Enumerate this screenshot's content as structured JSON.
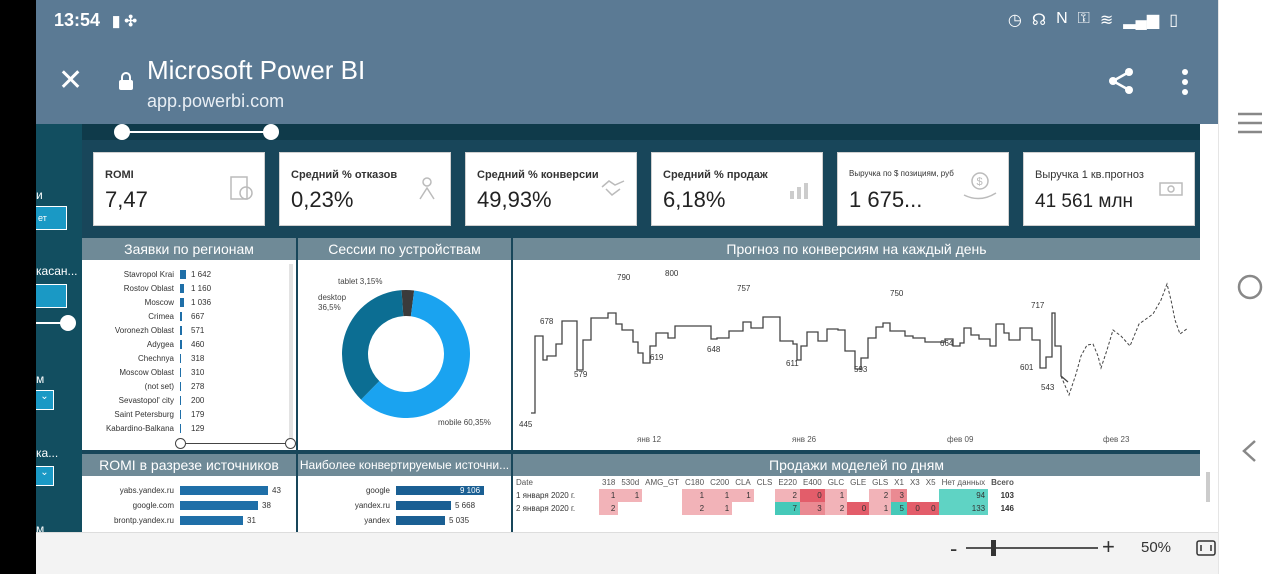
{
  "status_bar": {
    "time": "13:54"
  },
  "browser": {
    "title": "Microsoft Power BI",
    "url": "app.powerbi.com"
  },
  "sidebar": {
    "labels": [
      "и",
      "касан...",
      "м",
      "ка...",
      "м"
    ],
    "box_text": "ет"
  },
  "kpis": [
    {
      "label": "ROMI",
      "value": "7,47"
    },
    {
      "label": "Средний % отказов",
      "value": "0,23%"
    },
    {
      "label": "Средний % конверсии",
      "value": "49,93%"
    },
    {
      "label": "Средний % продаж",
      "value": "6,18%"
    },
    {
      "label": "Выручка по $ позициям, руб",
      "value": "1 675..."
    },
    {
      "label": "Выручка 1 кв.прогноз",
      "value": "41 561 млн"
    }
  ],
  "panels": {
    "regions_title": "Заявки по регионам",
    "devices_title": "Сессии по устройствам",
    "forecast_title": "Прогноз по конверсиям на каждый день",
    "romi_title": "ROMI в разрезе источников",
    "sources_title": "Наиболее конвертируемые источни...",
    "sales_title": "Продажи моделей по дням"
  },
  "regions": [
    {
      "name": "Stavropol Krai",
      "value": "1 642",
      "num": 1642
    },
    {
      "name": "Rostov Oblast",
      "value": "1 160",
      "num": 1160
    },
    {
      "name": "Moscow",
      "value": "1 036",
      "num": 1036
    },
    {
      "name": "Crimea",
      "value": "667",
      "num": 667
    },
    {
      "name": "Voronezh Oblast",
      "value": "571",
      "num": 571
    },
    {
      "name": "Adygea",
      "value": "460",
      "num": 460
    },
    {
      "name": "Chechnya",
      "value": "318",
      "num": 318
    },
    {
      "name": "Moscow Oblast",
      "value": "310",
      "num": 310
    },
    {
      "name": "(not set)",
      "value": "278",
      "num": 278
    },
    {
      "name": "Sevastopol' city",
      "value": "200",
      "num": 200
    },
    {
      "name": "Saint Petersburg",
      "value": "179",
      "num": 179
    },
    {
      "name": "Kabardino-Balkana",
      "value": "129",
      "num": 129
    }
  ],
  "devices": {
    "slices": [
      {
        "name": "mobile",
        "label": "mobile 60,35%",
        "value": 60.35,
        "color": "#1aa3f0"
      },
      {
        "name": "desktop",
        "label": "desktop 36,5%",
        "value": 36.5,
        "color": "#0c6e93"
      },
      {
        "name": "tablet",
        "label": "tablet 3,15%",
        "value": 3.15,
        "color": "#3b3b3b"
      }
    ]
  },
  "forecast": {
    "labels": [
      "445",
      "678",
      "579",
      "790",
      "619",
      "800",
      "648",
      "757",
      "611",
      "593",
      "750",
      "664",
      "601",
      "717",
      "543"
    ],
    "ticks": [
      "янв 12",
      "янв 26",
      "фев 09",
      "фев 23"
    ]
  },
  "romi_sources": [
    {
      "name": "yabs.yandex.ru",
      "value": "43",
      "num": 43
    },
    {
      "name": "google.com",
      "value": "38",
      "num": 38
    },
    {
      "name": "brontp.yandex.ru",
      "value": "31",
      "num": 31
    }
  ],
  "conv_sources": [
    {
      "name": "google",
      "value": "9 106",
      "num": 9106
    },
    {
      "name": "yandex.ru",
      "value": "5 668",
      "num": 5668
    },
    {
      "name": "yandex",
      "value": "5 035",
      "num": 5035
    }
  ],
  "sales_table": {
    "headers": [
      "Date",
      "318",
      "530d",
      "AMG_GT",
      "C180",
      "C200",
      "CLA",
      "CLS",
      "E220",
      "E400",
      "GLC",
      "GLE",
      "GLS",
      "X1",
      "X3",
      "X5",
      "Нет данных",
      "Всего"
    ],
    "rows": [
      [
        "1 января 2020 г.",
        "1",
        "1",
        "",
        "1",
        "1",
        "1",
        "",
        "2",
        "0",
        "1",
        "",
        "2",
        "3",
        "",
        "",
        "94",
        "103"
      ],
      [
        "2 января 2020 г.",
        "2",
        "",
        "",
        "2",
        "1",
        "",
        "",
        "7",
        "3",
        "2",
        "0",
        "1",
        "5",
        "0",
        "0",
        "133",
        "146"
      ]
    ]
  },
  "zoom": {
    "level": "50%",
    "minus": "-",
    "plus": "+"
  }
}
